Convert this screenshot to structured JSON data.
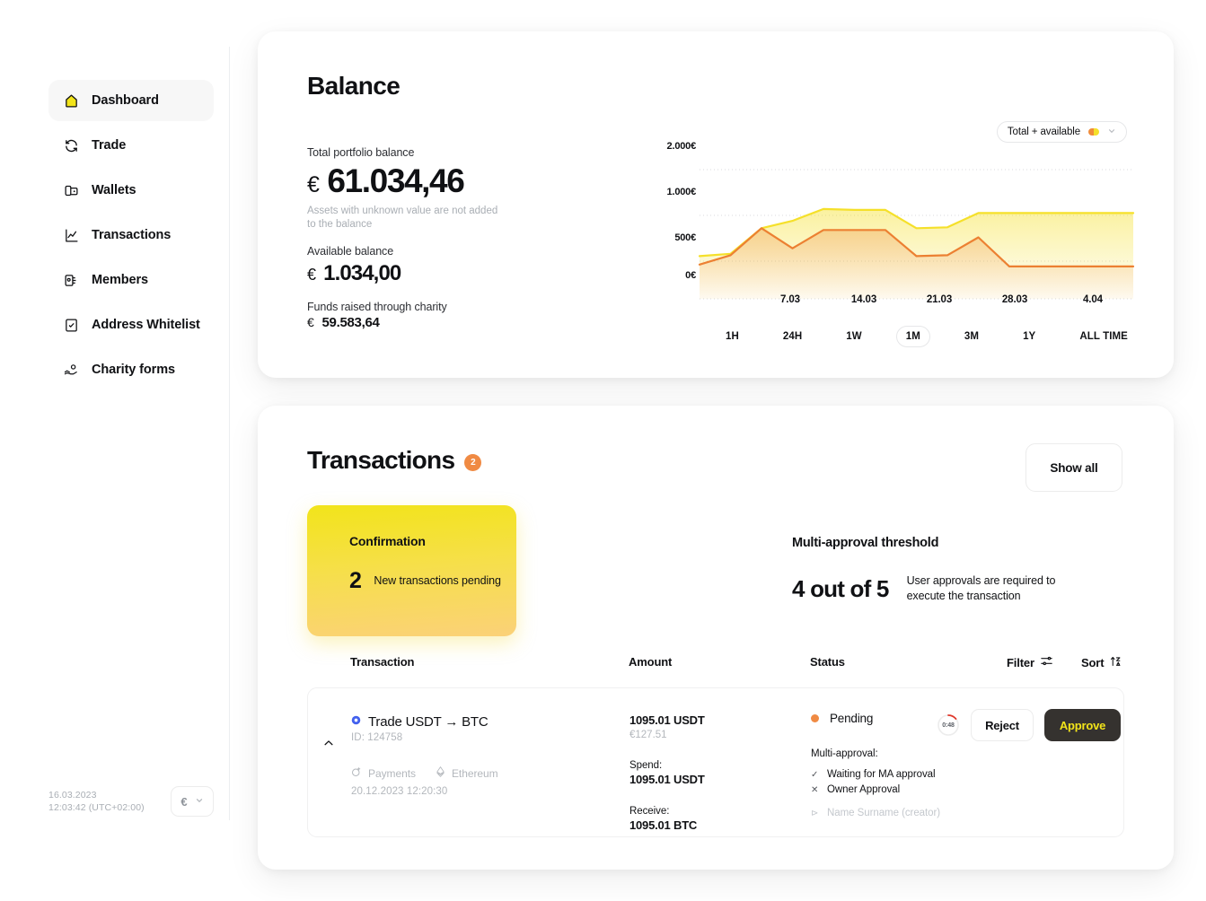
{
  "sidebar": {
    "items": [
      {
        "label": "Dashboard",
        "icon": "home-icon",
        "active": true
      },
      {
        "label": "Trade",
        "icon": "swap-icon",
        "active": false
      },
      {
        "label": "Wallets",
        "icon": "wallet-icon",
        "active": false
      },
      {
        "label": "Transactions",
        "icon": "chart-line-icon",
        "active": false
      },
      {
        "label": "Members",
        "icon": "members-icon",
        "active": false
      },
      {
        "label": "Address Whitelist",
        "icon": "checklist-icon",
        "active": false
      },
      {
        "label": "Charity forms",
        "icon": "hand-heart-icon",
        "active": false
      }
    ],
    "footer": {
      "date": "16.03.2023",
      "time": "12:03:42 (UTC+02:00)",
      "currency": "€"
    }
  },
  "balance": {
    "title": "Balance",
    "total_label": "Total portfolio balance",
    "total_symbol": "€",
    "total_value": "61.034,46",
    "total_note": "Assets with unknown value are not added to the balance",
    "available_label": "Available balance",
    "available_symbol": "€",
    "available_value": "1.034,00",
    "charity_label": "Funds raised through charity",
    "charity_symbol": "€",
    "charity_value": "59.583,64"
  },
  "chart_data": {
    "type": "area",
    "title": "",
    "xlabel": "",
    "ylabel": "",
    "dropdown_label": "Total + available",
    "legend": [
      {
        "name": "Total",
        "color": "#F5E02A"
      },
      {
        "name": "Available",
        "color": "#EC8032"
      }
    ],
    "ytick_labels": [
      "2.000€",
      "1.000€",
      "500€",
      "0€"
    ],
    "ytick_values": [
      2000,
      1000,
      500,
      0
    ],
    "xtick_labels": [
      "7.03",
      "14.03",
      "21.03",
      "28.03",
      "4.04"
    ],
    "ylim": [
      0,
      2000
    ],
    "grid": true,
    "x": [
      1,
      2,
      3,
      4,
      5,
      6,
      7,
      8,
      9,
      10,
      11,
      12,
      13,
      14,
      15
    ],
    "series": [
      {
        "name": "Total",
        "color": "#F5E02A",
        "values": [
          555,
          580,
          860,
          940,
          1140,
          1120,
          1120,
          860,
          870,
          1050,
          1050,
          1050,
          1050,
          1050,
          1050
        ]
      },
      {
        "name": "Available",
        "color": "#EC8032",
        "values": [
          455,
          565,
          860,
          640,
          840,
          840,
          840,
          555,
          565,
          760,
          430,
          430,
          430,
          430,
          430
        ]
      }
    ],
    "ranges": [
      {
        "label": "1H",
        "active": false
      },
      {
        "label": "24H",
        "active": false
      },
      {
        "label": "1W",
        "active": false
      },
      {
        "label": "1M",
        "active": true
      },
      {
        "label": "3M",
        "active": false
      },
      {
        "label": "1Y",
        "active": false
      },
      {
        "label": "ALL TIME",
        "active": false
      }
    ]
  },
  "transactions": {
    "title": "Transactions",
    "badge": "2",
    "show_all": "Show all",
    "confirmation": {
      "title": "Confirmation",
      "count": "2",
      "text": "New transactions pending"
    },
    "multi_approval": {
      "title": "Multi-approval threshold",
      "count": "4 out of 5",
      "description": "User approvals are required to execute the transaction"
    },
    "columns": {
      "transaction": "Transaction",
      "amount": "Amount",
      "status": "Status",
      "filter": "Filter",
      "sort": "Sort"
    },
    "rows": [
      {
        "name": "Trade USDT → BTC",
        "id": "ID: 124758",
        "tag_payments": "Payments",
        "tag_network": "Ethereum",
        "datetime": "20.12.2023 12:20:30",
        "amount_main": "1095.01 USDT",
        "amount_fiat": "€127.51",
        "spend_label": "Spend:",
        "spend_value": "1095.01 USDT",
        "receive_label": "Receive:",
        "receive_value": "1095.01 BTC",
        "status": "Pending",
        "timer": "0:48",
        "reject": "Reject",
        "approve": "Approve",
        "ma_label": "Multi-approval:",
        "ma_items": [
          {
            "mark": "✓",
            "text": "Waiting for MA approval",
            "muted": false
          },
          {
            "mark": "✕",
            "text": "Owner Approval",
            "muted": false
          },
          {
            "mark": "⊳",
            "text": "Name Surname (creator)",
            "muted": true
          }
        ]
      }
    ]
  },
  "colors": {
    "accent_yellow": "#F2E41A",
    "accent_orange": "#F08A43",
    "dark": "#35322f",
    "total_line": "#F5E02A",
    "available_line": "#EC8032"
  }
}
